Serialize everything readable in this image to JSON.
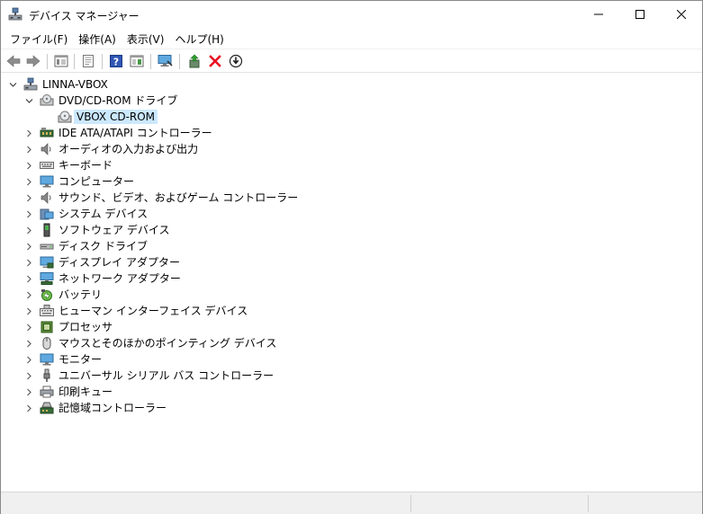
{
  "window": {
    "title": "デバイス マネージャー",
    "icon": "device-manager-icon"
  },
  "menu": [
    {
      "label": "ファイル(F)"
    },
    {
      "label": "操作(A)"
    },
    {
      "label": "表示(V)"
    },
    {
      "label": "ヘルプ(H)"
    }
  ],
  "toolbar": [
    {
      "name": "back-arrow-icon"
    },
    {
      "name": "forward-arrow-icon"
    },
    {
      "name": "show-hide-console-tree-icon"
    },
    {
      "name": "properties-icon"
    },
    {
      "name": "help-icon"
    },
    {
      "name": "action-pane-icon"
    },
    {
      "name": "scan-hardware-icon"
    },
    {
      "name": "update-driver-icon"
    },
    {
      "name": "uninstall-device-icon"
    },
    {
      "name": "disable-device-icon"
    }
  ],
  "tree": {
    "root": {
      "label": "LINNA-VBOX",
      "icon": "computer-icon",
      "expanded": true
    },
    "dvd": {
      "label": "DVD/CD-ROM ドライブ",
      "icon": "dvd-drive-icon",
      "expanded": true
    },
    "dvd_child": {
      "label": "VBOX CD-ROM",
      "icon": "cd-rom-icon",
      "selected": true
    },
    "categories": [
      {
        "label": "IDE ATA/ATAPI コントローラー",
        "icon": "ide-controller-icon"
      },
      {
        "label": "オーディオの入力および出力",
        "icon": "speaker-icon"
      },
      {
        "label": "キーボード",
        "icon": "keyboard-icon"
      },
      {
        "label": "コンピューター",
        "icon": "monitor-icon"
      },
      {
        "label": "サウンド、ビデオ、およびゲーム コントローラー",
        "icon": "speaker-icon"
      },
      {
        "label": "システム デバイス",
        "icon": "system-device-icon"
      },
      {
        "label": "ソフトウェア デバイス",
        "icon": "software-device-icon"
      },
      {
        "label": "ディスク ドライブ",
        "icon": "disk-drive-icon"
      },
      {
        "label": "ディスプレイ アダプター",
        "icon": "display-adapter-icon"
      },
      {
        "label": "ネットワーク アダプター",
        "icon": "network-adapter-icon"
      },
      {
        "label": "バッテリ",
        "icon": "battery-icon"
      },
      {
        "label": "ヒューマン インターフェイス デバイス",
        "icon": "hid-icon"
      },
      {
        "label": "プロセッサ",
        "icon": "processor-icon"
      },
      {
        "label": "マウスとそのほかのポインティング デバイス",
        "icon": "mouse-icon"
      },
      {
        "label": "モニター",
        "icon": "monitor-icon"
      },
      {
        "label": "ユニバーサル シリアル バス コントローラー",
        "icon": "usb-icon"
      },
      {
        "label": "印刷キュー",
        "icon": "printer-icon"
      },
      {
        "label": "記憶域コントローラー",
        "icon": "storage-controller-icon"
      }
    ]
  },
  "colors": {
    "selection": "#cce8ff",
    "delete_red": "#e81123",
    "help_blue": "#2f55b4"
  }
}
